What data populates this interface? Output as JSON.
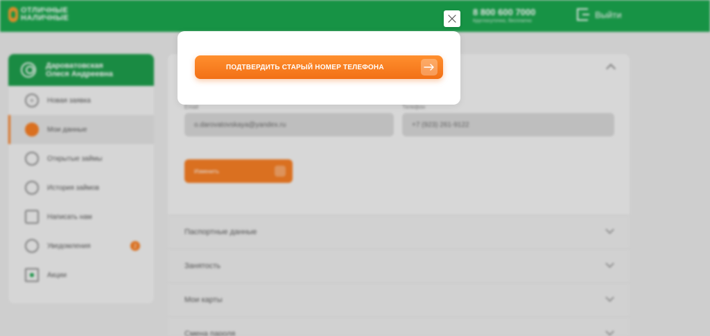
{
  "header": {
    "logo_line1": "ОТЛИЧНЫЕ",
    "logo_line2": "НАЛИЧНЫЕ",
    "phone_number": "8 800 600 7000",
    "phone_note": "Круглосуточно, бесплатно",
    "logout_label": "Выйти"
  },
  "sidebar": {
    "user_name_line1": "Дароватовская",
    "user_name_line2": "Олеся Андреевна",
    "items": [
      {
        "label": "Новая заявка",
        "icon": "plus-circle-icon"
      },
      {
        "label": "Мои данные",
        "icon": "user-icon",
        "active": true
      },
      {
        "label": "Открытые займы",
        "icon": "coins-icon"
      },
      {
        "label": "История займов",
        "icon": "history-icon"
      },
      {
        "label": "Написать нам",
        "icon": "mail-icon"
      },
      {
        "label": "Уведомления",
        "icon": "bell-icon",
        "badge": "2"
      },
      {
        "label": "Акции",
        "icon": "promo-icon"
      }
    ]
  },
  "profile": {
    "email_label": "Email",
    "email_value": "o.darovatovskaya@yandex.ru",
    "phone_label": "Телефон",
    "phone_value": "+7 (923) 261-9122",
    "change_button": "Изменить",
    "sections": [
      "Паспортные данные",
      "Занятость",
      "Мои карты",
      "Смена пароля"
    ]
  },
  "modal": {
    "confirm_button": "ПОДТВЕРДИТЬ СТАРЫЙ НОМЕР ТЕЛЕФОНА",
    "confirm_icon": "arrow-right-icon",
    "close_icon": "close-icon"
  },
  "colors": {
    "brand_green": "#16a34a",
    "accent_orange": "#f47b20"
  }
}
